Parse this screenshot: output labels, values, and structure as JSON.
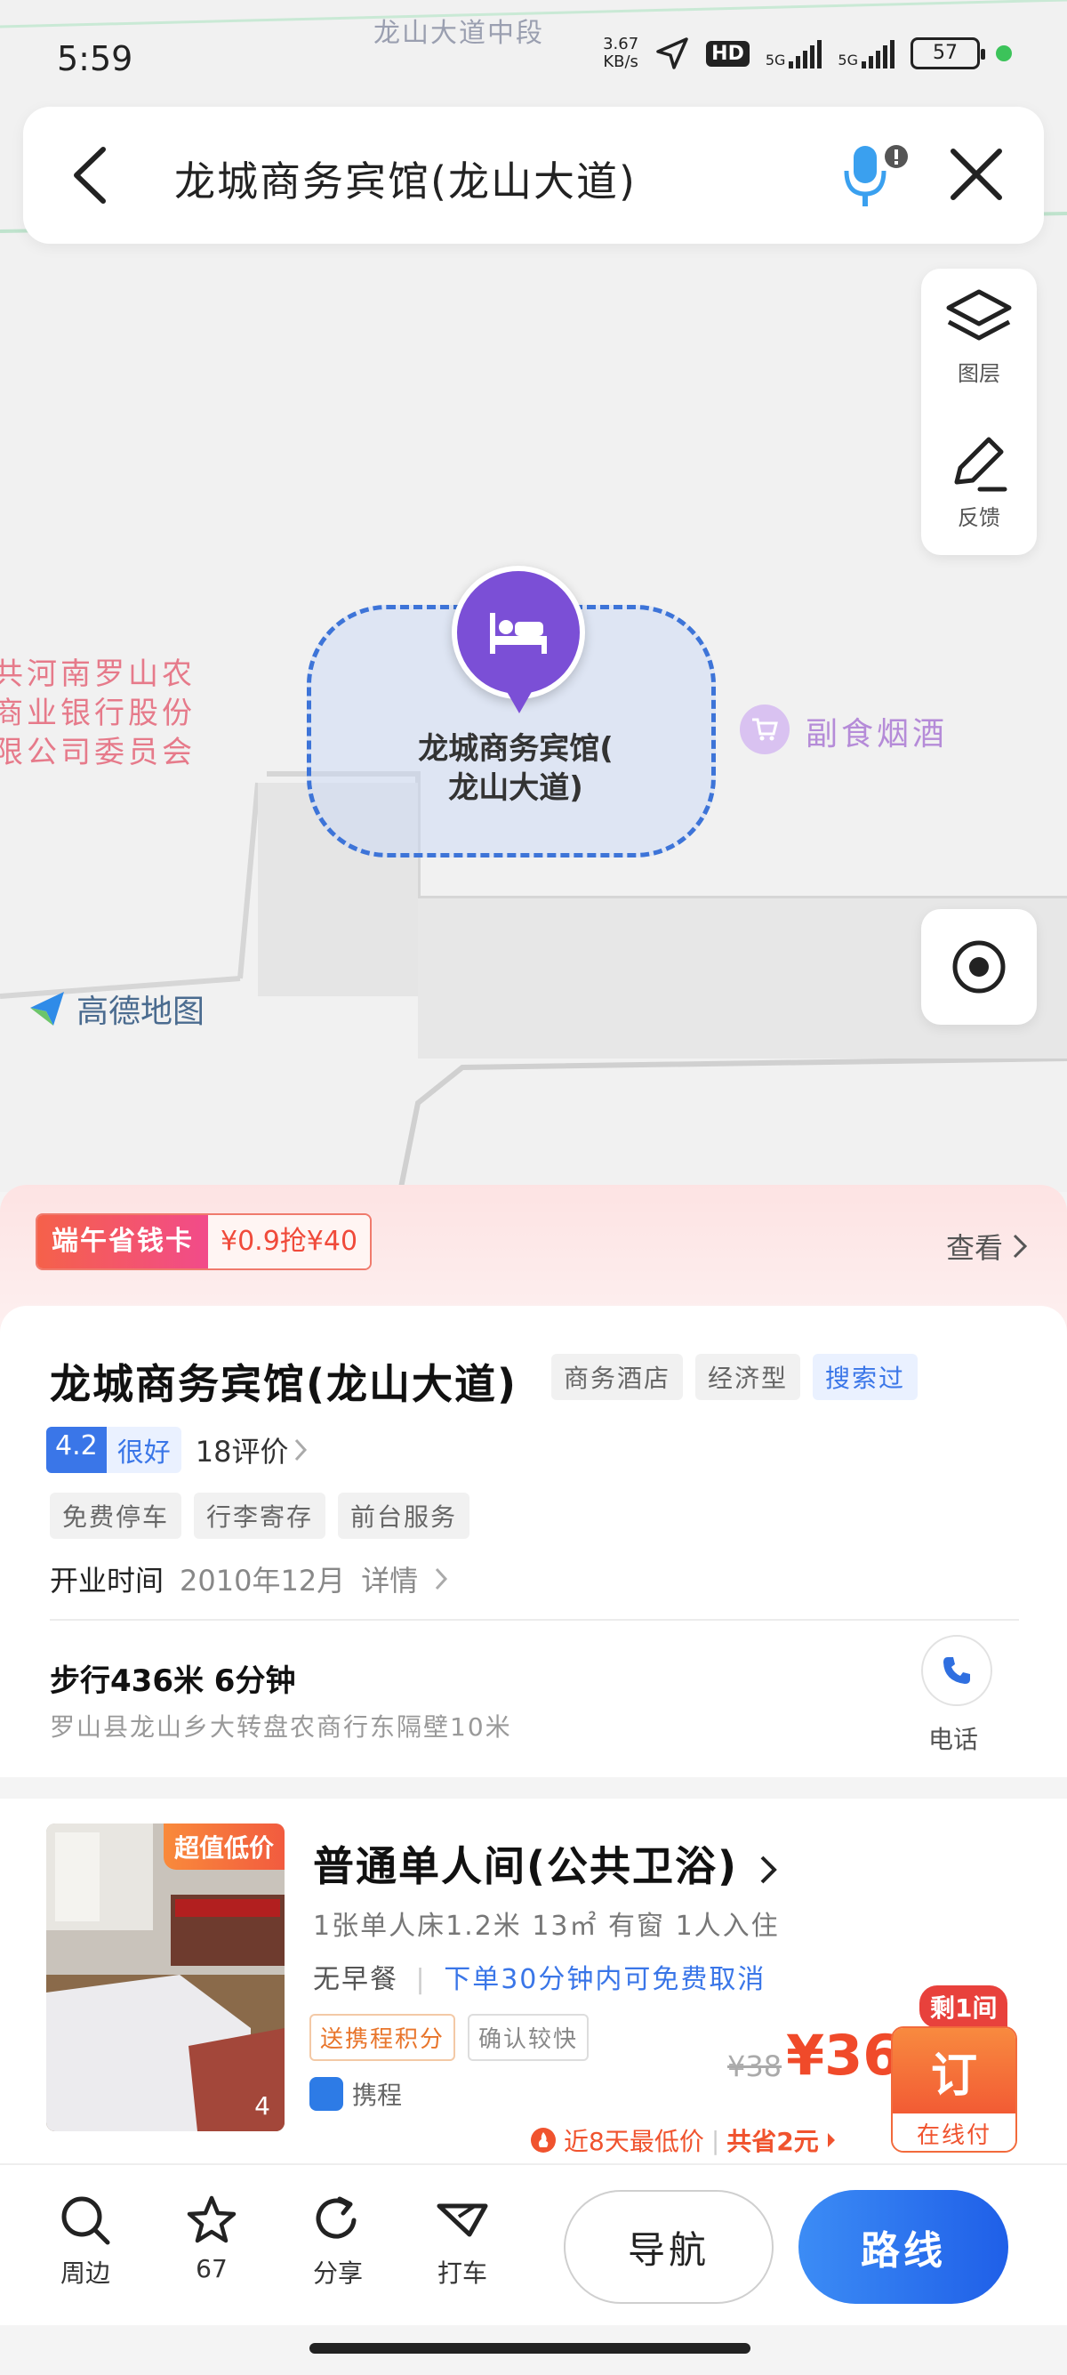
{
  "status_bar": {
    "time": "5:59",
    "net_speed_value": "3.67",
    "net_speed_unit": "KB/s",
    "hd_label": "HD",
    "sim1": "5G",
    "sim2": "5G",
    "battery": "57"
  },
  "map": {
    "road_label": "龙山大道中段",
    "left_poi_lines": [
      "共河南罗山农",
      "商业银行股份",
      "限公司委员会"
    ],
    "shop_label": "副食烟酒",
    "pin_label_line1": "龙城商务宾馆(",
    "pin_label_line2": "龙山大道)",
    "brand": "高德地图",
    "layers_label": "图层",
    "feedback_label": "反馈"
  },
  "search": {
    "query": "龙城商务宾馆(龙山大道)"
  },
  "promo": {
    "card_label": "端午省钱卡",
    "offer": "¥0.9抢¥40",
    "view": "查看"
  },
  "hotel": {
    "name": "龙城商务宾馆(龙山大道)",
    "tags": [
      "商务酒店",
      "经济型"
    ],
    "searched_tag": "搜索过",
    "rating": "4.2",
    "rating_word": "很好",
    "reviews": "18评价",
    "amenities": [
      "免费停车",
      "行李寄存",
      "前台服务"
    ],
    "open_label": "开业时间",
    "open_value": "2010年12月",
    "details": "详情",
    "walk": "步行436米 6分钟",
    "address": "罗山县龙山乡大转盘农商行东隔壁10米",
    "phone_label": "电话"
  },
  "room": {
    "badge": "超值低价",
    "photo_count": "4",
    "title": "普通单人间(公共卫浴)",
    "spec": "1张单人床1.2米  13㎡  有窗  1人入住",
    "breakfast": "无早餐",
    "cancel": "下单30分钟内可免费取消",
    "tag1": "送携程积分",
    "tag2": "确认较快",
    "provider": "携程",
    "left": "剩1间",
    "price_old": "¥38",
    "price_now": "¥36",
    "book": "订",
    "pay": "在线付",
    "low_note": "近8天最低价",
    "save_note": "共省2元"
  },
  "actions": {
    "nearby": "周边",
    "favorites": "67",
    "share": "分享",
    "taxi": "打车",
    "navigate": "导航",
    "route": "路线"
  },
  "colors": {
    "accent_blue": "#3a76e8",
    "pin_purple": "#7b4fd6",
    "price_orange": "#f04a2a"
  }
}
